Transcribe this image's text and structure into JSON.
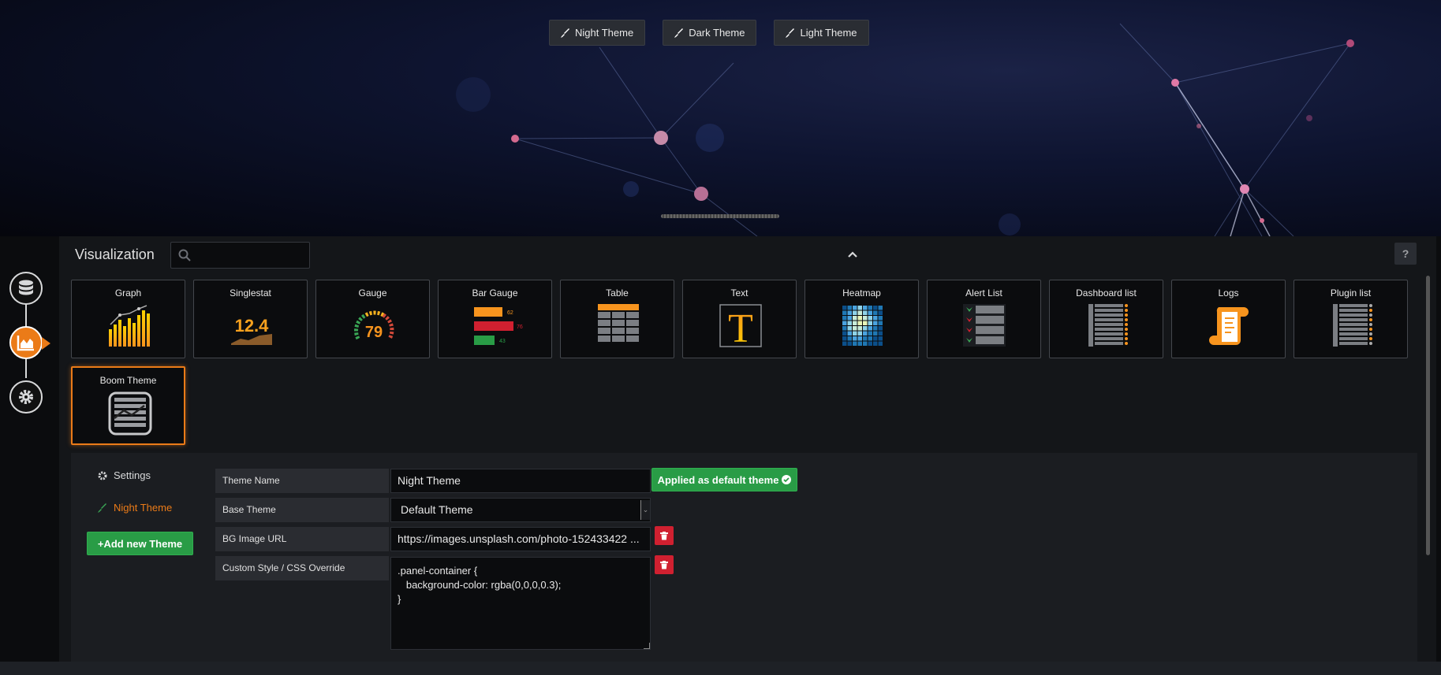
{
  "theme_buttons": [
    {
      "label": "Night Theme"
    },
    {
      "label": "Dark Theme"
    },
    {
      "label": "Light Theme"
    }
  ],
  "visualization": {
    "title": "Visualization",
    "search_placeholder": "",
    "help_label": "?",
    "cards": [
      {
        "label": "Graph",
        "icon": "graph-icon"
      },
      {
        "label": "Singlestat",
        "icon": "singlestat-icon",
        "value": "12.4"
      },
      {
        "label": "Gauge",
        "icon": "gauge-icon",
        "value": "79"
      },
      {
        "label": "Bar Gauge",
        "icon": "bar-gauge-icon",
        "values": [
          "62",
          "76",
          "43"
        ]
      },
      {
        "label": "Table",
        "icon": "table-icon"
      },
      {
        "label": "Text",
        "icon": "text-icon",
        "glyph": "T"
      },
      {
        "label": "Heatmap",
        "icon": "heatmap-icon"
      },
      {
        "label": "Alert List",
        "icon": "alert-list-icon"
      },
      {
        "label": "Dashboard list",
        "icon": "dashboard-list-icon"
      },
      {
        "label": "Logs",
        "icon": "logs-icon"
      },
      {
        "label": "Plugin list",
        "icon": "plugin-list-icon"
      },
      {
        "label": "Boom Theme",
        "icon": "boom-theme-icon",
        "selected": true
      }
    ]
  },
  "settings": {
    "tabs": [
      {
        "label": "Settings",
        "icon": "gear-icon"
      },
      {
        "label": "Night Theme",
        "icon": "brush-icon",
        "active": true
      }
    ],
    "add_button": "+Add new Theme",
    "fields": {
      "theme_name_label": "Theme Name",
      "theme_name_value": "Night Theme",
      "applied_button": "Applied as default theme",
      "base_theme_label": "Base Theme",
      "base_theme_value": "Default Theme",
      "bg_image_label": "BG Image URL",
      "bg_image_value": "https://images.unsplash.com/photo-152433422 ...",
      "css_label": "Custom Style / CSS Override",
      "css_value": ".panel-container {\n   background-color: rgba(0,0,0,0.3);\n}"
    }
  },
  "colors": {
    "accent": "#eb7b18",
    "success": "#299c46",
    "danger": "#d02030"
  }
}
